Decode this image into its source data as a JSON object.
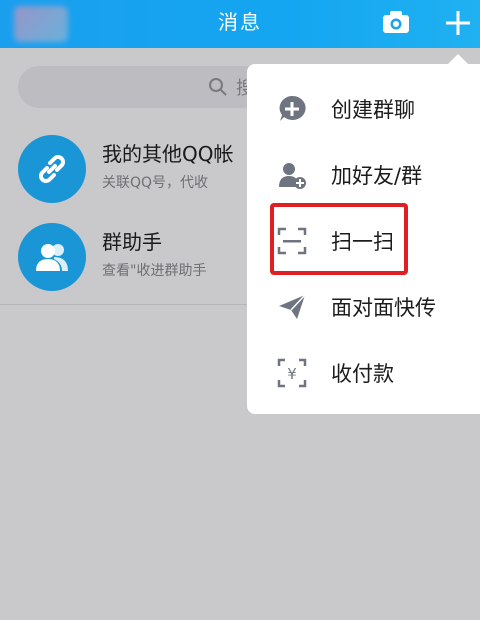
{
  "header": {
    "title": "消息",
    "camera_icon": "camera-icon",
    "plus_icon": "plus-icon",
    "accent": "#1a9fef"
  },
  "search": {
    "placeholder_visible": "搜"
  },
  "conversations": [
    {
      "name": "我的其他QQ帐",
      "preview": "关联QQ号，代收",
      "icon": "link-icon"
    },
    {
      "name": "群助手",
      "preview": "查看\"收进群助手",
      "icon": "group-icon"
    }
  ],
  "menu": {
    "items": [
      {
        "label": "创建群聊",
        "icon": "create-group-icon"
      },
      {
        "label": "加好友/群",
        "icon": "add-friend-icon"
      },
      {
        "label": "扫一扫",
        "icon": "scan-icon"
      },
      {
        "label": "面对面快传",
        "icon": "paper-plane-icon"
      },
      {
        "label": "收付款",
        "icon": "payment-icon"
      }
    ],
    "highlight_color": "#e01f25"
  }
}
